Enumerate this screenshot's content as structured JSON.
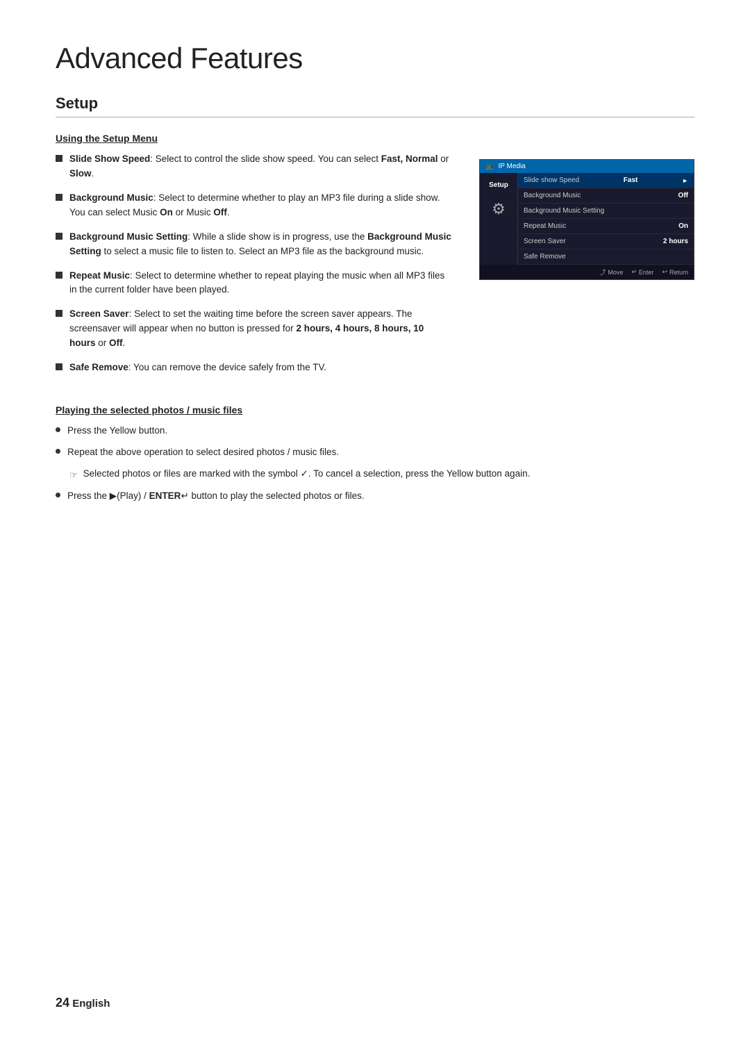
{
  "page": {
    "title": "Advanced Features",
    "section": "Setup",
    "footer_page": "24",
    "footer_language": "English"
  },
  "subsections": {
    "setup_menu": {
      "title": "Using the Setup Menu",
      "bullets": [
        {
          "id": 1,
          "html": "<strong>Slide Show Speed</strong>: Select to control the slide show speed. You can select <strong>Fast, Normal</strong> or <strong>Slow</strong>."
        },
        {
          "id": 2,
          "html": "<strong>Background Music</strong>: Select to determine whether to play an MP3 file during a slide show. You can select Music <strong>On</strong> or Music <strong>Off</strong>."
        },
        {
          "id": 3,
          "html": "<strong>Background Music Setting</strong>: While a slide show is in progress, use the <strong>Background Music Setting</strong> to select a music file to listen to. Select an MP3 file as the background music."
        },
        {
          "id": 4,
          "html": "<strong>Repeat Music</strong>: Select to determine whether to repeat playing the music when all MP3 files in the current folder have been played."
        },
        {
          "id": 5,
          "html": "<strong>Screen Saver</strong>: Select to set the waiting time before the screen saver appears. The screensaver will appear when no button is pressed for <strong>2 hours, 4 hours, 8 hours, 10 hours</strong> or <strong>Off</strong>."
        },
        {
          "id": 6,
          "html": "<strong>Safe Remove</strong>: You can remove the device safely from the TV."
        }
      ]
    },
    "playing_section": {
      "title": "Playing the selected photos / music files",
      "bullets": [
        {
          "id": 1,
          "html": "Press the Yellow button."
        },
        {
          "id": 2,
          "html": "Repeat the above operation to select desired photos / music files."
        },
        {
          "id": 3,
          "html": "Selected photos or files are marked with the symbol ✓. To cancel a selection, press the Yellow button again.",
          "indented": true
        },
        {
          "id": 4,
          "html": "Press the ▶(Play) / <strong>ENTER</strong>↵ button to play the selected photos or files."
        }
      ]
    }
  },
  "tv_menu": {
    "header_text": "IP Media",
    "sidebar_label": "Setup",
    "rows": [
      {
        "label": "Slide show Speed",
        "value": "Fast",
        "has_arrow": true,
        "highlighted": true
      },
      {
        "label": "Background Music",
        "value": "Off",
        "has_arrow": false,
        "highlighted": false
      },
      {
        "label": "Background Music Setting",
        "value": "",
        "has_arrow": false,
        "highlighted": false
      },
      {
        "label": "Repeat Music",
        "value": "On",
        "has_arrow": false,
        "highlighted": false
      },
      {
        "label": "Screen Saver",
        "value": "2 hours",
        "has_arrow": false,
        "highlighted": false
      },
      {
        "label": "Safe Remove",
        "value": "",
        "has_arrow": false,
        "highlighted": false
      }
    ],
    "footer": {
      "move": "Move",
      "enter": "Enter",
      "return": "Return"
    }
  }
}
